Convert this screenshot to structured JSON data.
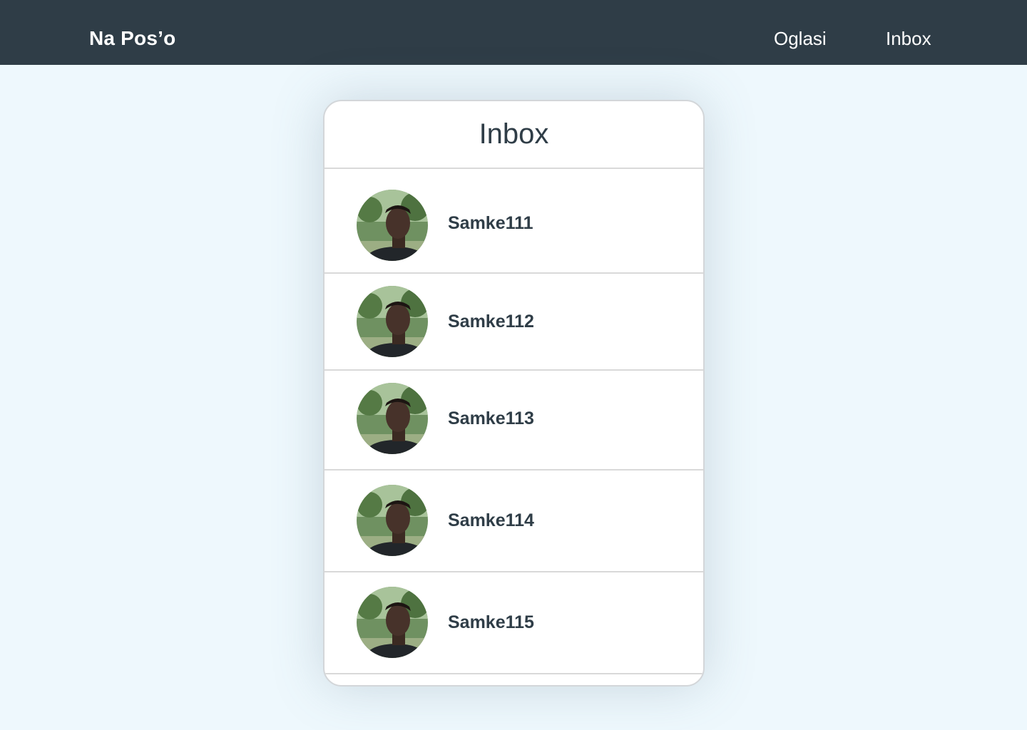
{
  "header": {
    "brand": "Na Pos’o",
    "nav": [
      {
        "label": "Oglasi"
      },
      {
        "label": "Inbox"
      }
    ]
  },
  "inbox": {
    "title": "Inbox",
    "conversations": [
      {
        "username": "Samke111"
      },
      {
        "username": "Samke112"
      },
      {
        "username": "Samke113"
      },
      {
        "username": "Samke114"
      },
      {
        "username": "Samke115"
      }
    ]
  },
  "colors": {
    "topbar": "#2f3d47",
    "page_background": "#eef8fd",
    "text_dark": "#2f3d47"
  }
}
